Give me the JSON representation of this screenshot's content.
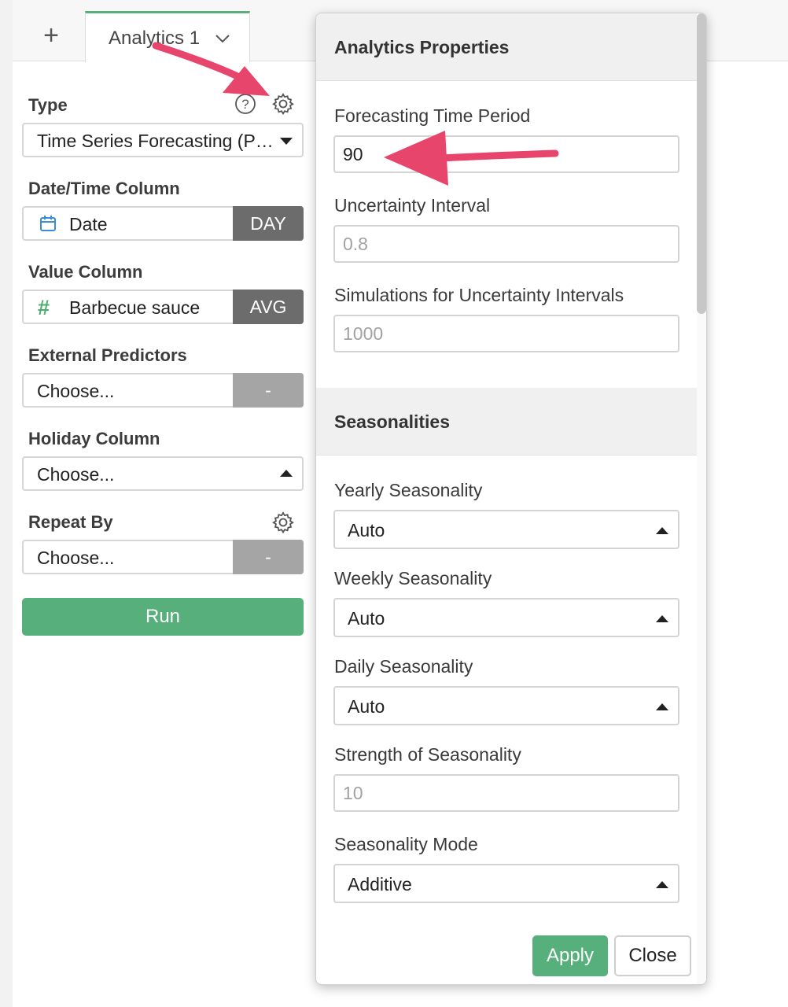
{
  "tabbar": {
    "add_label": "+",
    "tab_label": "Analytics 1"
  },
  "left_panel": {
    "type_label": "Type",
    "type_value": "Time Series Forecasting (P…",
    "datetime_label": "Date/Time Column",
    "datetime_value": "Date",
    "datetime_unit": "DAY",
    "value_label": "Value Column",
    "value_value": "Barbecue sauce",
    "value_agg": "AVG",
    "ext_label": "External Predictors",
    "ext_value": "Choose...",
    "ext_btn": "-",
    "holiday_label": "Holiday Column",
    "holiday_value": "Choose...",
    "repeat_label": "Repeat By",
    "repeat_value": "Choose...",
    "repeat_btn": "-",
    "run_label": "Run",
    "icons": [
      "help-icon",
      "gear-icon",
      "calendar-icon",
      "hash-icon",
      "caret-down-icon",
      "caret-up-icon",
      "chevron-down-icon"
    ]
  },
  "dialog": {
    "title": "Analytics Properties",
    "forecast_label": "Forecasting Time Period",
    "forecast_value": "90",
    "uncertainty_label": "Uncertainty Interval",
    "uncertainty_placeholder": "0.8",
    "simulations_label": "Simulations for Uncertainty Intervals",
    "simulations_placeholder": "1000",
    "seasonalities_title": "Seasonalities",
    "yearly_label": "Yearly Seasonality",
    "yearly_value": "Auto",
    "weekly_label": "Weekly Seasonality",
    "weekly_value": "Auto",
    "daily_label": "Daily Seasonality",
    "daily_value": "Auto",
    "strength_label": "Strength of Seasonality",
    "strength_placeholder": "10",
    "mode_label": "Seasonality Mode",
    "mode_value": "Additive",
    "apply_label": "Apply",
    "close_label": "Close"
  },
  "colors": {
    "accent_green": "#57b07b",
    "arrow_pink": "#e8456c",
    "dark_button": "#6c6c6c"
  }
}
